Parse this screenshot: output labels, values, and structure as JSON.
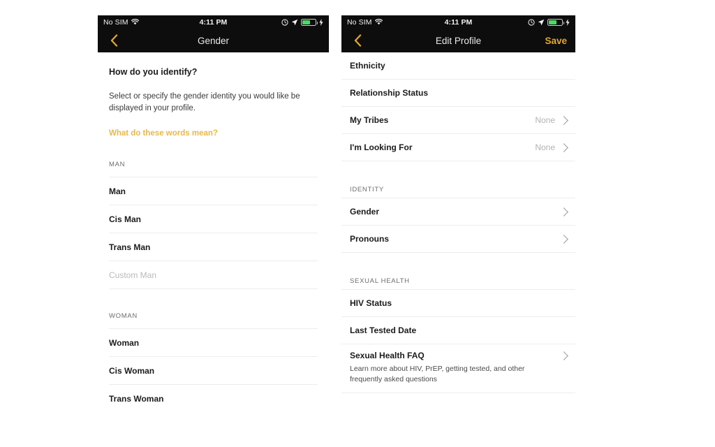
{
  "status_bar": {
    "carrier": "No SIM",
    "time": "4:11 PM",
    "wifi_icon": "wifi-icon",
    "alarm_icon": "alarm-clock-icon",
    "location_icon": "location-arrow-icon",
    "battery_icon": "battery-icon",
    "charging_icon": "lightning-bolt-icon",
    "battery_level_percent": 62,
    "battery_color": "#4cd964"
  },
  "theme": {
    "accent_gold": "#e2a72e",
    "link_gold": "#e8b84b",
    "navbar_background": "#0d0d0d",
    "divider": "#ededed",
    "text_primary": "#1b1b1b",
    "text_muted": "#b3b3b3"
  },
  "left_screen": {
    "nav": {
      "back_icon": "chevron-left-icon",
      "title": "Gender"
    },
    "heading": "How do you identify?",
    "description": "Select or specify the gender identity you would like be displayed in your profile.",
    "link_label": "What do these words mean?",
    "sections": [
      {
        "header": "MAN",
        "options": [
          {
            "label": "Man",
            "style": "normal"
          },
          {
            "label": "Cis Man",
            "style": "normal"
          },
          {
            "label": "Trans Man",
            "style": "normal"
          },
          {
            "label": "Custom Man",
            "style": "placeholder"
          }
        ]
      },
      {
        "header": "WOMAN",
        "options": [
          {
            "label": "Woman",
            "style": "normal"
          },
          {
            "label": "Cis Woman",
            "style": "normal"
          },
          {
            "label": "Trans Woman",
            "style": "normal"
          }
        ]
      }
    ]
  },
  "right_screen": {
    "nav": {
      "back_icon": "chevron-left-icon",
      "title": "Edit Profile",
      "save_label": "Save"
    },
    "group_profile": {
      "rows": [
        {
          "label": "Ethnicity",
          "value": "",
          "chevron": false
        },
        {
          "label": "Relationship Status",
          "value": "",
          "chevron": false
        },
        {
          "label": "My Tribes",
          "value": "None",
          "chevron": true
        },
        {
          "label": "I'm Looking For",
          "value": "None",
          "chevron": true
        }
      ]
    },
    "group_identity": {
      "header": "IDENTITY",
      "rows": [
        {
          "label": "Gender",
          "value": "",
          "chevron": true
        },
        {
          "label": "Pronouns",
          "value": "",
          "chevron": true
        }
      ]
    },
    "group_sexual_health": {
      "header": "SEXUAL HEALTH",
      "rows": [
        {
          "label": "HIV Status",
          "value": "",
          "chevron": false
        },
        {
          "label": "Last Tested Date",
          "value": "",
          "chevron": false
        }
      ],
      "faq": {
        "title": "Sexual Health FAQ",
        "description": "Learn more about HIV, PrEP, getting tested, and other frequently asked questions",
        "chevron": true
      }
    }
  }
}
